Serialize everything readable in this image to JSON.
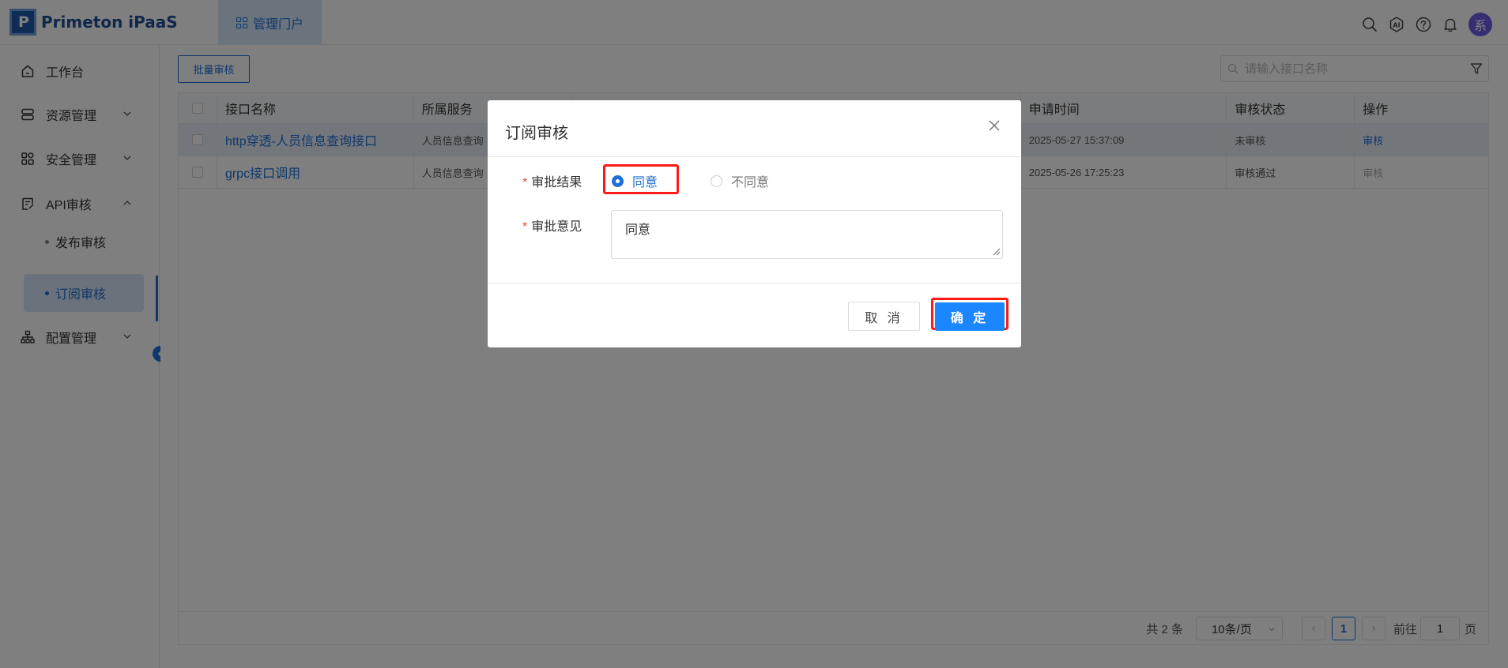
{
  "app": {
    "logo_text": "Primeton iPaaS"
  },
  "header": {
    "nav_tab": "管理门户",
    "avatar_text": "系",
    "ai_label": "AI"
  },
  "sidebar": {
    "items": [
      {
        "label": "工作台",
        "icon": "home-icon"
      },
      {
        "label": "资源管理",
        "icon": "server-icon"
      },
      {
        "label": "安全管理",
        "icon": "apps-icon"
      },
      {
        "label": "API审核",
        "icon": "document-icon"
      },
      {
        "label": "配置管理",
        "icon": "org-chart-icon"
      }
    ],
    "sub_items": [
      {
        "label": "发布审核"
      },
      {
        "label": "订阅审核",
        "active": true
      }
    ]
  },
  "toolbar": {
    "batch_label": "批量审核",
    "search_placeholder": "请输入接口名称"
  },
  "table": {
    "columns": [
      "接口名称",
      "所属服务",
      "",
      "申请时间",
      "审核状态",
      "操作"
    ],
    "rows": [
      {
        "name": "http穿透-人员信息查询接口",
        "service": "人员信息查询",
        "time": "2025-05-27 15:37:09",
        "status": "未审核",
        "action": "审核",
        "action_enabled": true
      },
      {
        "name": "grpc接口调用",
        "service": "人员信息查询",
        "time": "2025-05-26 17:25:23",
        "status": "审核通过",
        "action": "审核",
        "action_enabled": false
      }
    ]
  },
  "pagination": {
    "total": "共 2 条",
    "page_size": "10条/页",
    "current_page": "1",
    "goto_label": "前往",
    "goto_value": "1",
    "page_suffix": "页"
  },
  "dialog": {
    "title": "订阅审核",
    "result_label": "审批结果",
    "options": [
      {
        "label": "同意",
        "checked": true
      },
      {
        "label": "不同意",
        "checked": false
      }
    ],
    "opinion_label": "审批意见",
    "opinion_value": "同意",
    "cancel_label": "取 消",
    "confirm_label": "确 定"
  },
  "colors": {
    "primary": "#1f6fd6",
    "confirm": "#1a86ff",
    "highlight": "#ff1a1a",
    "required": "#e84c3d"
  }
}
